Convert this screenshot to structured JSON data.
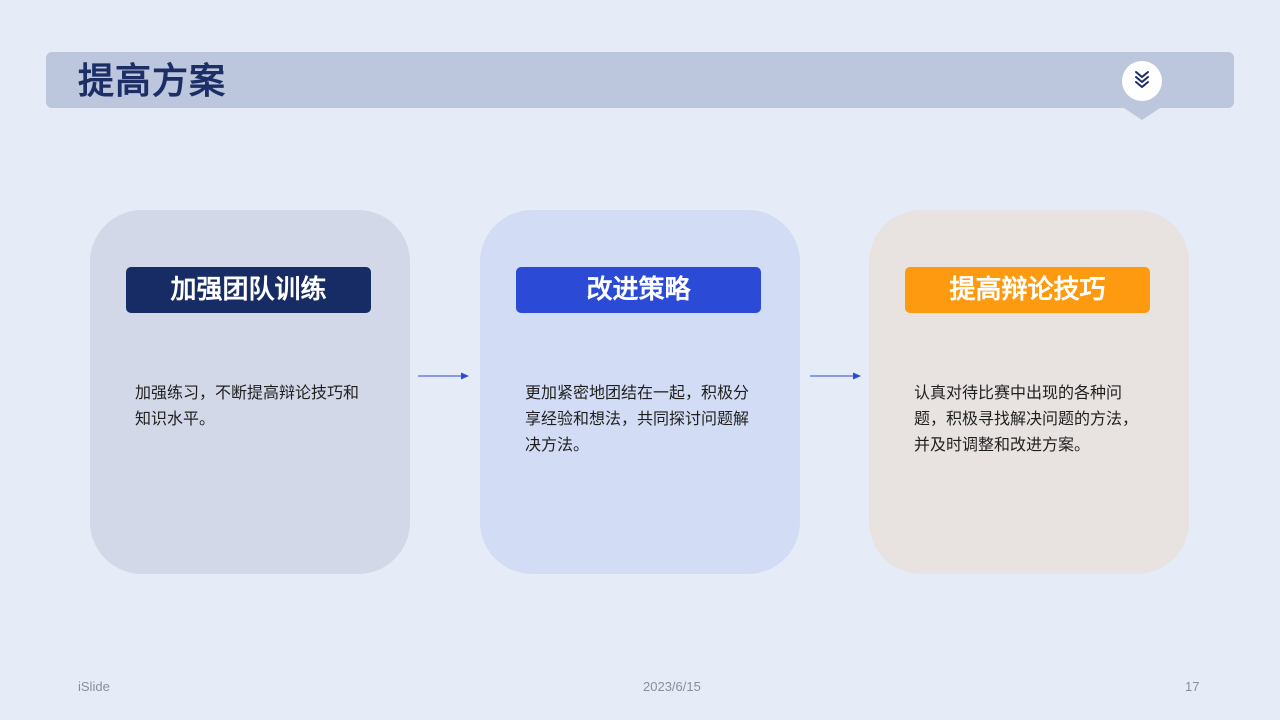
{
  "header": {
    "title": "提高方案",
    "badge_icon": "double-chevron-down-icon"
  },
  "cards": [
    {
      "title": "加强团队训练",
      "body": "加强练习，不断提高辩论技巧和知识水平。",
      "accent_color": "#172c64"
    },
    {
      "title": "改进策略",
      "body": "更加紧密地团结在一起，积极分享经验和想法，共同探讨问题解决方法。",
      "accent_color": "#2b4bd6"
    },
    {
      "title": "提高辩论技巧",
      "body": "认真对待比赛中出现的各种问题，积极寻找解决问题的方法，并及时调整和改进方案。",
      "accent_color": "#fe9a10"
    }
  ],
  "footer": {
    "brand": "iSlide",
    "date": "2023/6/15",
    "page_number": "17"
  }
}
